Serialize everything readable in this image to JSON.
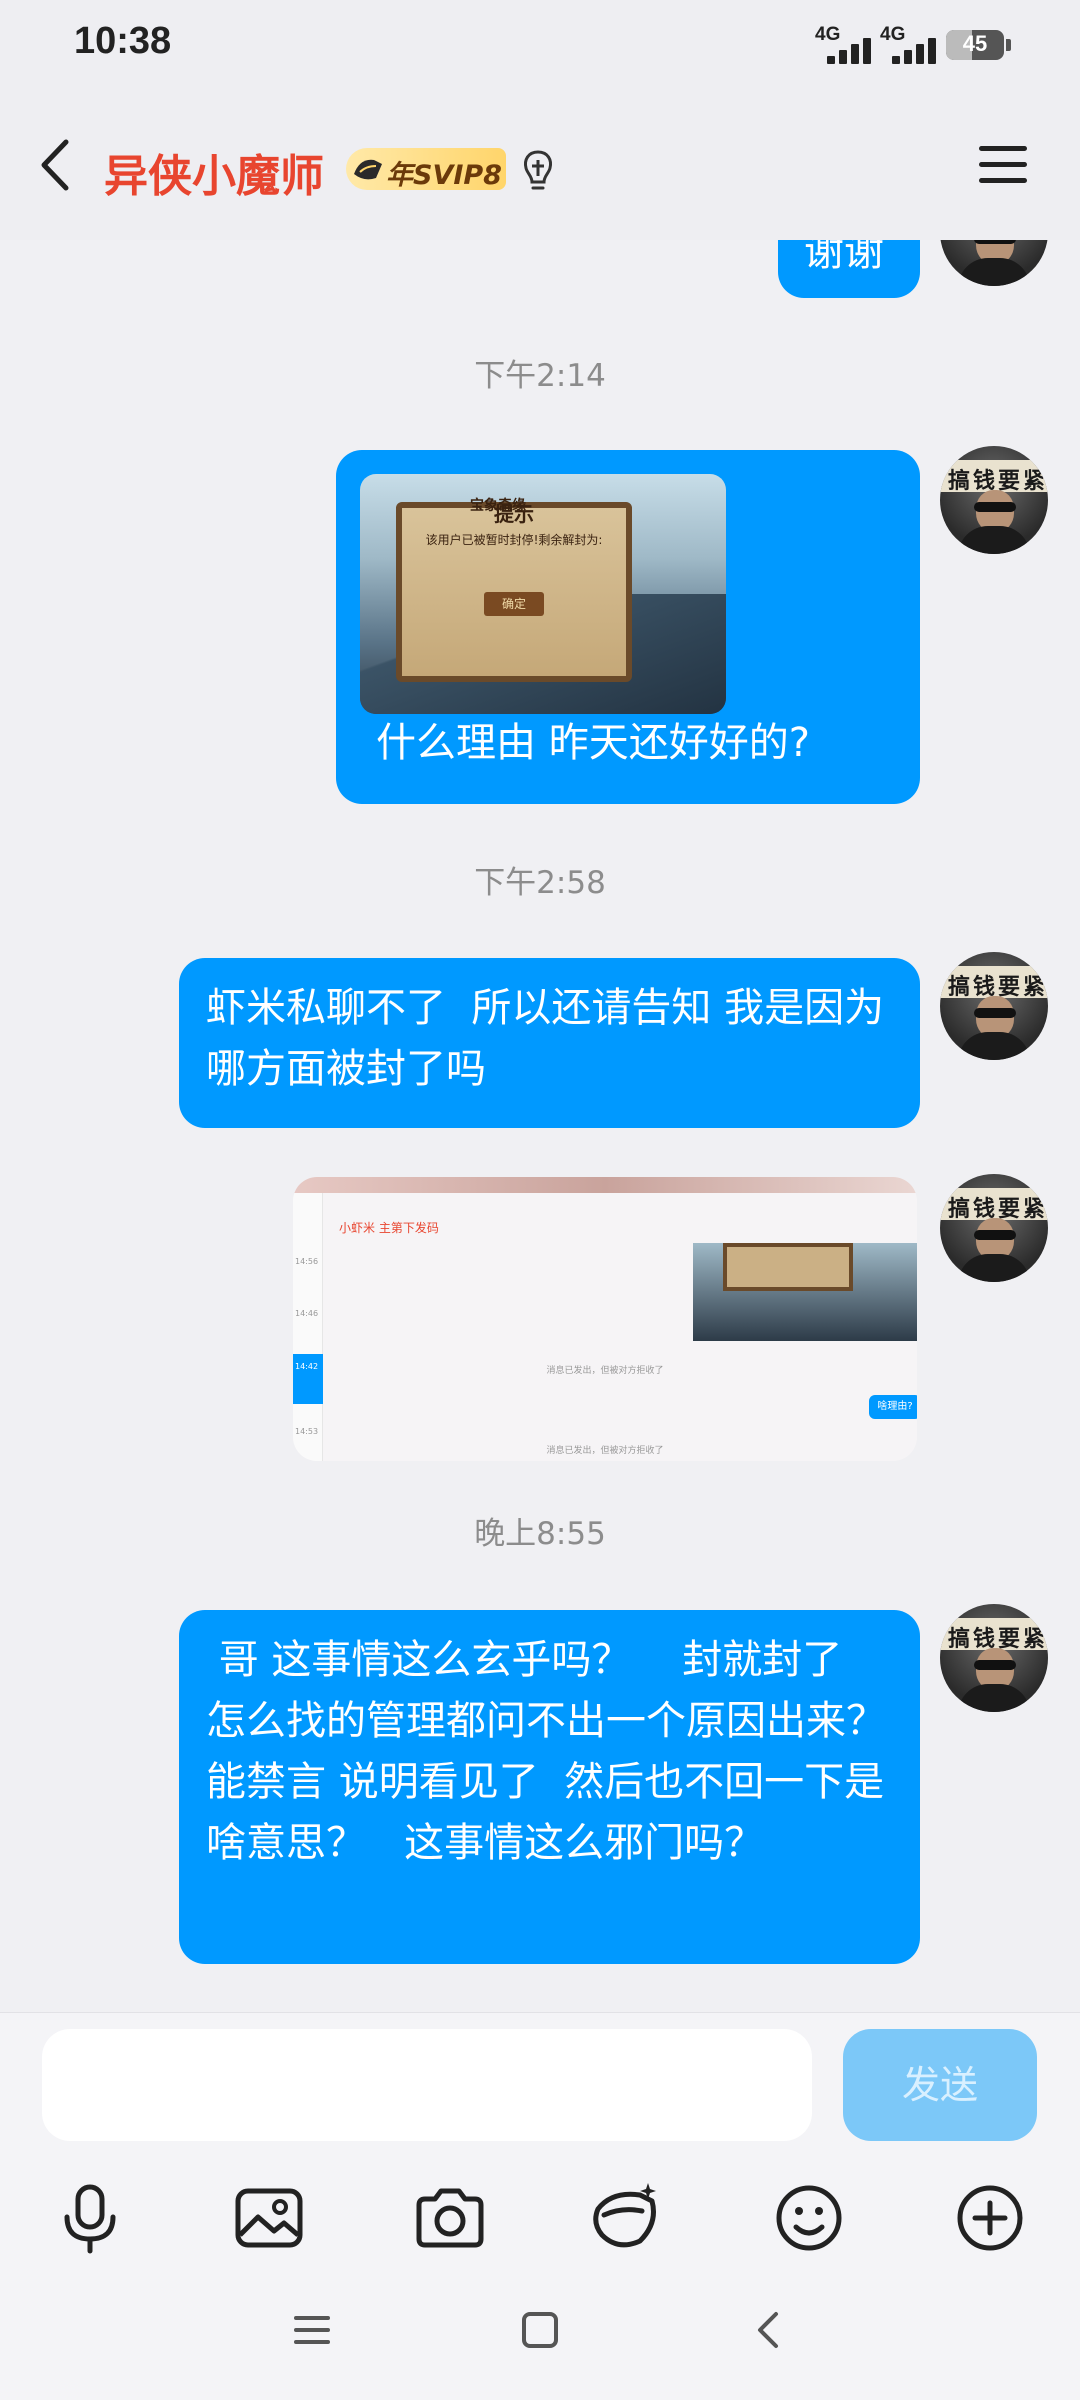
{
  "status_bar": {
    "time": "10:38",
    "network_1": "4G",
    "network_2": "4G",
    "battery": "45",
    "battery_level": 0.45
  },
  "header": {
    "contact_name": "异侠小魔师",
    "vip_badge": "年SVIP8",
    "name_color": "#e8452f"
  },
  "messages": [
    {
      "type": "text",
      "text": "谢谢"
    },
    {
      "type": "timestamp",
      "text": "下午2:14"
    },
    {
      "type": "image_text",
      "text": "什么理由  昨天还好好的?"
    },
    {
      "type": "timestamp",
      "text": "下午2:58"
    },
    {
      "type": "text",
      "text": "虾米私聊不了  所以还请告知 我是因为哪方面被封了吗"
    },
    {
      "type": "image"
    },
    {
      "type": "timestamp",
      "text": "晚上8:55"
    },
    {
      "type": "text",
      "text": " 哥 这事情这么玄乎吗？    封就封了 怎么找的管理都问不出一个原因出来？   能禁言 说明看见了  然后也不回一下是啥意思？   这事情这么邪门吗？"
    }
  ],
  "game_image": {
    "banner": "宝象奇缘",
    "dialog_title": "提示",
    "dialog_message": "该用户已被暂时封停!剩余解封为:",
    "confirm_label": "确定"
  },
  "screenshot_image": {
    "chat_title": "小虾米 主第下发码",
    "times": [
      "14:56",
      "14:46",
      "14:42",
      "14:53"
    ],
    "note_1": "消息已发出，但被对方拒收了",
    "note_2": "消息已发出，但被对方拒收了",
    "bubble": "啥理由?"
  },
  "input": {
    "placeholder": "",
    "send_label": "发送"
  },
  "toolbar": [
    "microphone-icon",
    "image-icon",
    "camera-icon",
    "red-packet-icon",
    "emoji-icon",
    "plus-icon"
  ],
  "colors": {
    "bubble": "#0099ff",
    "send_button": "#7cc8f8",
    "background": "#f0f0f3"
  }
}
